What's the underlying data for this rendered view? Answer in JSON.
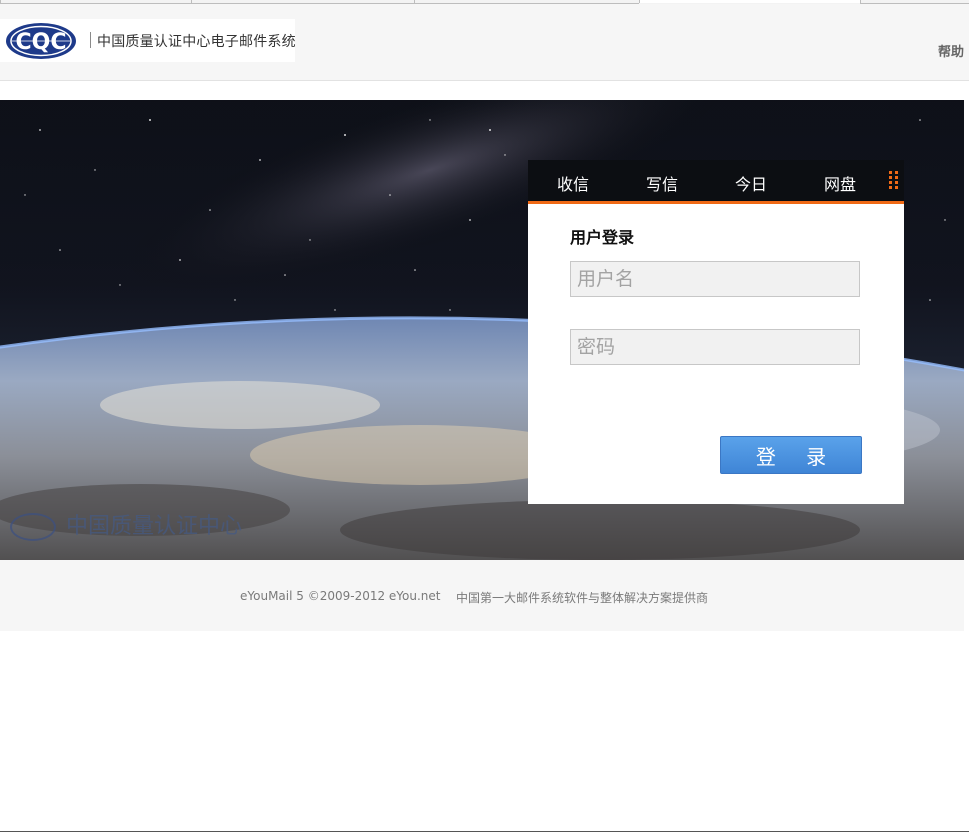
{
  "header": {
    "logo_letters": "CQC",
    "system_name": "中国质量认证中心电子邮件系统",
    "help_label": "帮助"
  },
  "hero": {
    "watermark_text": "中国质量认证中心"
  },
  "login": {
    "nav": [
      "收信",
      "写信",
      "今日",
      "网盘"
    ],
    "title": "用户登录",
    "username_placeholder": "用户名",
    "password_placeholder": "密码",
    "submit_label": "登 录"
  },
  "footer": {
    "copyright": "eYouMail 5 ©2009-2012 eYou.net",
    "tagline": "中国第一大邮件系统软件与整体解决方案提供商"
  },
  "colors": {
    "accent_orange": "#f06a16",
    "button_blue": "#4a90e2",
    "logo_blue": "#1e3a8a"
  }
}
